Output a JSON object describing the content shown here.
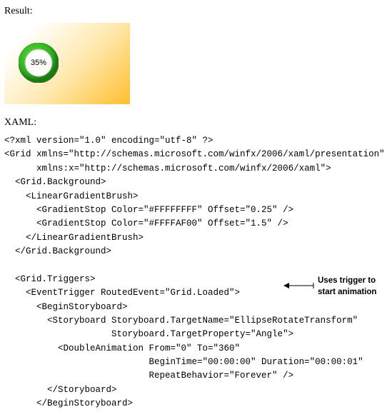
{
  "labels": {
    "result": "Result:",
    "xaml": "XAML:"
  },
  "chart_data": {
    "type": "pie",
    "title": "",
    "value": 35,
    "max": 100,
    "display": "35%",
    "ring_color": "#2fb41f",
    "ring_highlight": "#9de26a",
    "ring_shadow": "#1a7a12",
    "center_color": "#ffffff"
  },
  "code": {
    "l01": "<?xml version=\"1.0\" encoding=\"utf-8\" ?>",
    "l02": "<Grid xmlns=\"http://schemas.microsoft.com/winfx/2006/xaml/presentation\"",
    "l03": "      xmlns:x=\"http://schemas.microsoft.com/winfx/2006/xaml\">",
    "l04": "  <Grid.Background>",
    "l05": "    <LinearGradientBrush>",
    "l06": "      <GradientStop Color=\"#FFFFFFFF\" Offset=\"0.25\" />",
    "l07": "      <GradientStop Color=\"#FFFFAF00\" Offset=\"1.5\" />",
    "l08": "    </LinearGradientBrush>",
    "l09": "  </Grid.Background>",
    "l10": "",
    "l11": "  <Grid.Triggers>",
    "l12": "    <EventTrigger RoutedEvent=\"Grid.Loaded\">",
    "l13": "      <BeginStoryboard>",
    "l14": "        <Storyboard Storyboard.TargetName=\"EllipseRotateTransform\"",
    "l15": "                    Storyboard.TargetProperty=\"Angle\">",
    "l16": "          <DoubleAnimation From=\"0\" To=\"360\"",
    "l17": "                           BeginTime=\"00:00:00\" Duration=\"00:00:01\"",
    "l18": "                           RepeatBehavior=\"Forever\" />",
    "l19": "        </Storyboard>",
    "l20": "      </BeginStoryboard>"
  },
  "annotation": {
    "line1": "Uses trigger to",
    "line2": "start animation"
  }
}
